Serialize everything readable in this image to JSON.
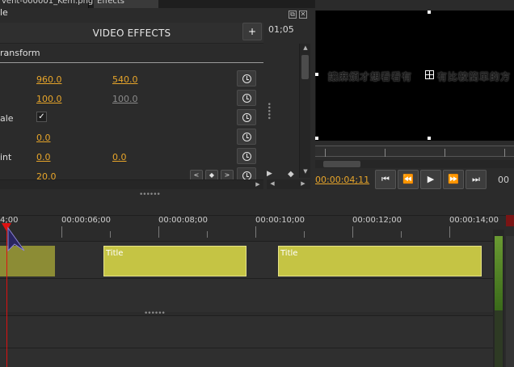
{
  "tabs": {
    "file_tab": "vent-000001_Kem.png",
    "filters_tab": "Effects",
    "side_tab_partial": "le"
  },
  "panel": {
    "title": "VIDEO EFFECTS",
    "add_button": "+",
    "section": "ransform",
    "rows": [
      {
        "label": "",
        "v1": "960.0",
        "v2": "540.0",
        "v2_dim": false
      },
      {
        "label": "",
        "v1": "100.0",
        "v2": "100.0",
        "v2_dim": true
      },
      {
        "label": "ale",
        "check": "✓"
      },
      {
        "label": "",
        "v1": "0.0"
      },
      {
        "label": "int",
        "v1": "0.0",
        "v2": "0.0",
        "v2_dim": false
      },
      {
        "label": "",
        "v1": "20.0"
      }
    ],
    "side_timecode": "01;05"
  },
  "icons": {
    "float": "float-icon",
    "close": "close-icon",
    "keyframe": "clock-icon"
  },
  "preview": {
    "subtitle_left": "讓麻煩才想看看有",
    "subtitle_right": "有比較簡單的方",
    "current_timecode": "00:00:04;11",
    "end_timecode": "00"
  },
  "transport": {
    "prev": "⏮",
    "rewind": "⏪",
    "play": "▶",
    "forward": "⏩",
    "next": "⏭"
  },
  "timeline": {
    "labels": [
      "4;00",
      "00:00:06;00",
      "00:00:08;00",
      "00:00:10;00",
      "00:00:12;00",
      "00:00:14;00"
    ],
    "clips": [
      {
        "title": ""
      },
      {
        "title": "Title"
      },
      {
        "title": "Title"
      }
    ]
  },
  "colors": {
    "accent_value": "#e7a52a",
    "clip": "#c5c444",
    "playhead": "#dd1111"
  }
}
